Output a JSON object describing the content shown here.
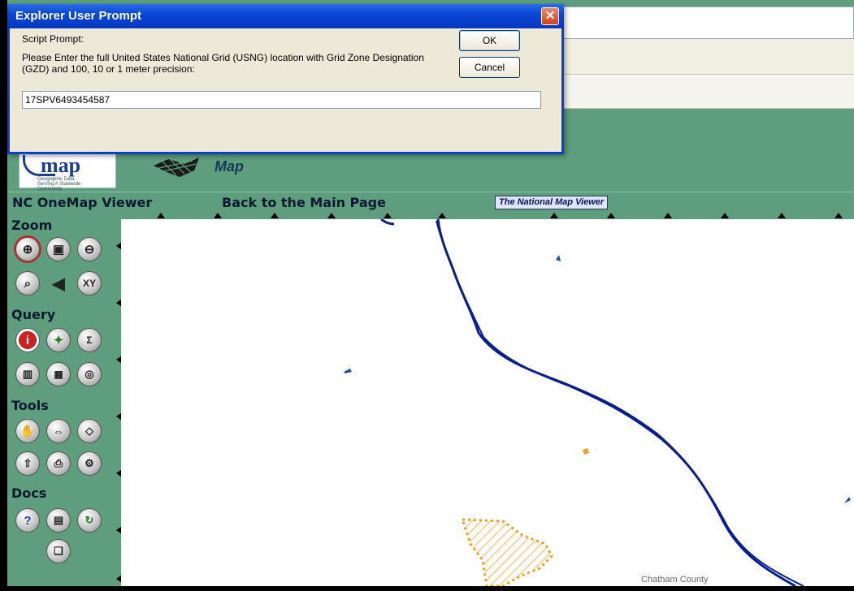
{
  "dialog": {
    "title": "Explorer User Prompt",
    "close_glyph": "✕",
    "prompt_label": "Script Prompt:",
    "message": "Please Enter the full United States National Grid (USNG) location with Grid Zone Designation (GZD) and 100, 10 or 1 meter precision:",
    "ok_label": "OK",
    "cancel_label": "Cancel",
    "input_value": "17SPV6493454587"
  },
  "header": {
    "logo_text": "map",
    "logo_subtext": "Geographic Data Serving A Statewide Community",
    "tnm_word": "Map"
  },
  "linkbar": {
    "viewer": "NC OneMap Viewer",
    "back": "Back to the Main Page",
    "national_viewer": "The National Map Viewer"
  },
  "panel": {
    "zoom": "Zoom",
    "query": "Query",
    "tools": "Tools",
    "docs": "Docs",
    "icons": {
      "zoom": [
        "zoom-in-icon",
        "zoom-box-icon",
        "zoom-out-icon",
        "full-extent-icon",
        "previous-extent-icon",
        "xy-zoom-icon"
      ],
      "query": [
        "identify-icon",
        "find-icon",
        "query-builder-icon",
        "chart-icon",
        "xy-table-icon",
        "buffer-icon"
      ],
      "tools": [
        "pan-icon",
        "measure-icon",
        "erase-icon",
        "upload-icon",
        "print-icon",
        "settings-icon"
      ],
      "docs": [
        "help-icon",
        "legend-icon",
        "refresh-icon",
        "documentation-icon"
      ]
    },
    "xy_label": "XY"
  },
  "map": {
    "county_label": "Chatham County",
    "colors": {
      "river": "#0a1e8c",
      "water": "#1f4f9c",
      "hatch": "#f0a020"
    }
  }
}
